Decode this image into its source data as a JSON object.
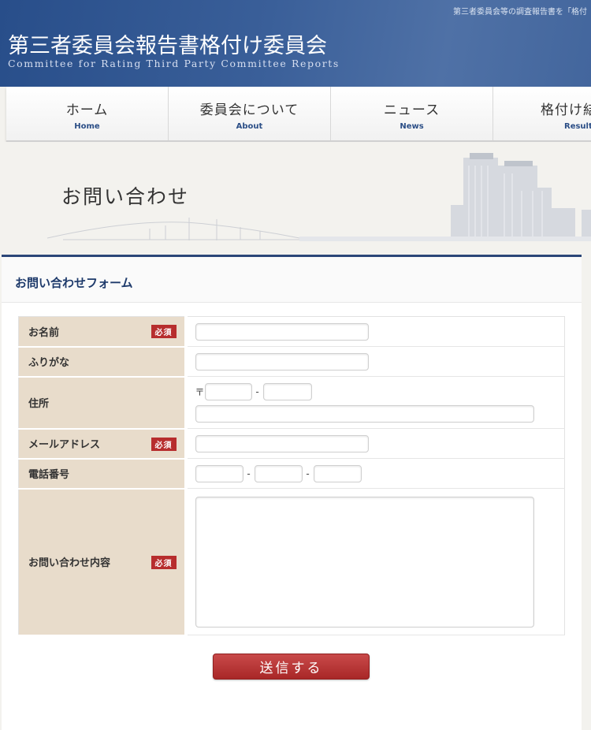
{
  "header": {
    "tagline": "第三者委員会等の調査報告書を「格付",
    "title": "第三者委員会報告書格付け委員会",
    "subtitle": "Committee for Rating Third Party Committee Reports"
  },
  "nav": {
    "items": [
      {
        "jp": "ホーム",
        "en": "Home"
      },
      {
        "jp": "委員会について",
        "en": "About"
      },
      {
        "jp": "ニュース",
        "en": "News"
      },
      {
        "jp": "格付け結",
        "en": "Result"
      }
    ]
  },
  "banner": {
    "title": "お問い合わせ"
  },
  "form": {
    "heading": "お問い合わせフォーム",
    "required_label": "必須",
    "fields": {
      "name": "お名前",
      "furigana": "ふりがな",
      "address": "住所",
      "zip_mark": "〒",
      "email": "メールアドレス",
      "phone": "電話番号",
      "message": "お問い合わせ内容"
    },
    "separator": "-",
    "submit_label": "送信する"
  },
  "colors": {
    "header_blue": "#3a5f99",
    "label_bg": "#e8dccb",
    "required_red": "#b72d2d",
    "submit_red": "#b83636"
  }
}
